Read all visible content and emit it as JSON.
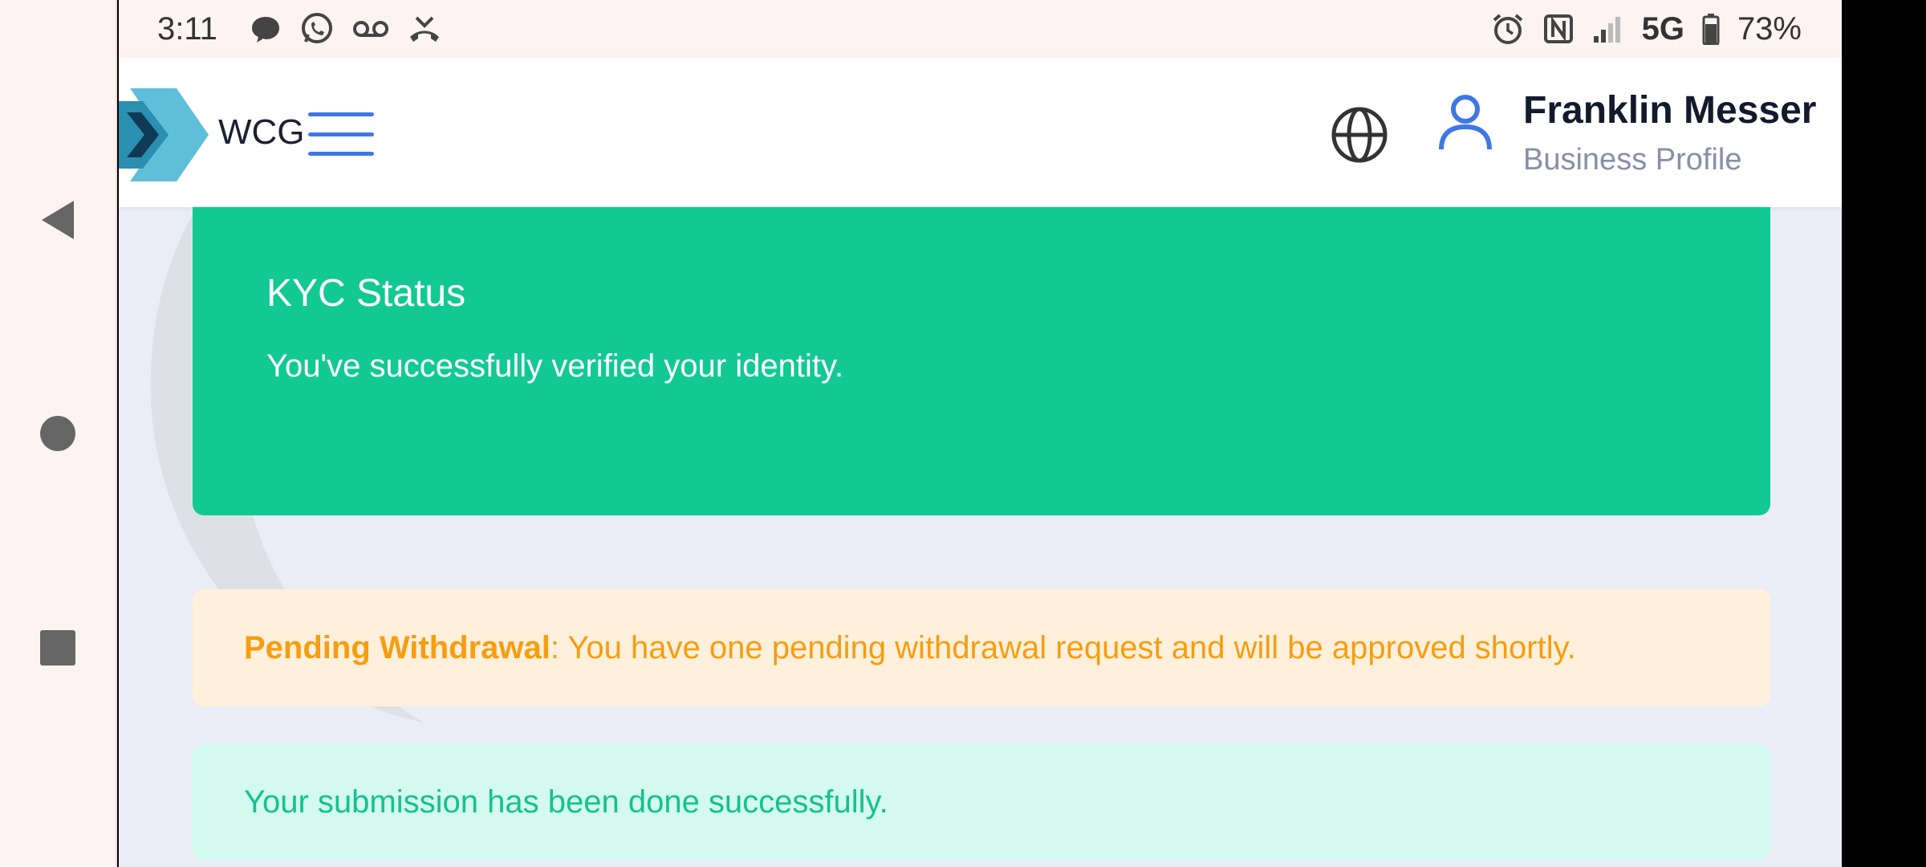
{
  "status_bar": {
    "time": "3:11",
    "left_icons": [
      "chat-bubble-icon",
      "whatsapp-icon",
      "voicemail-icon",
      "missed-call-icon"
    ],
    "right_icons": [
      "alarm-icon",
      "nfc-icon",
      "signal-icon"
    ],
    "network": "5G",
    "battery_percent": "73%"
  },
  "header": {
    "brand": "WCG",
    "user_name": "Franklin Messer",
    "user_role": "Business Profile"
  },
  "kyc": {
    "title": "KYC Status",
    "message": "You've successfully verified your identity."
  },
  "alerts": {
    "pending_label": "Pending Withdrawal",
    "pending_message": ": You have one pending withdrawal request and will be approved shortly.",
    "success_message": "Your submission has been done successfully."
  },
  "colors": {
    "kyc_green": "#12c993",
    "warning_bg": "#fff0dc",
    "warning_text": "#f79d10",
    "success_bg": "#d4f9ee",
    "success_text": "#14c290",
    "accent_blue": "#3e77e6"
  }
}
